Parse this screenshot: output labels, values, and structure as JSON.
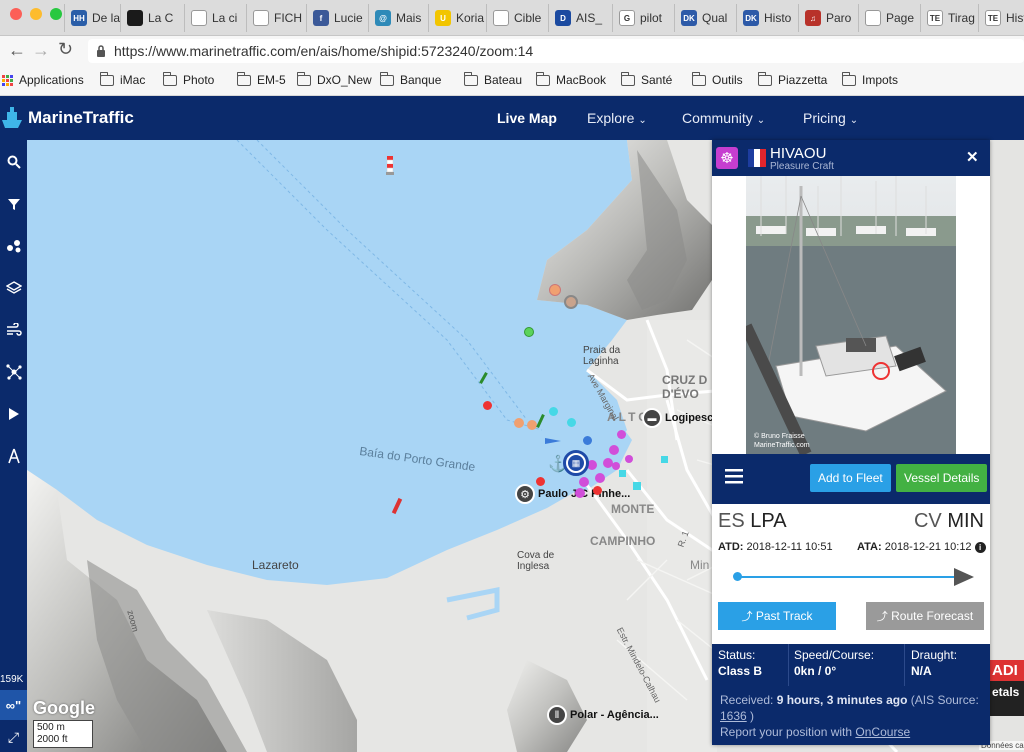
{
  "browser": {
    "tabs": [
      {
        "label": "De la",
        "icon": "hh-favicon",
        "color": "#2a5ea8",
        "glyph": "HH"
      },
      {
        "label": "La C",
        "icon": "flag-favicon",
        "color": "#1a1a1a",
        "glyph": ""
      },
      {
        "label": "La ci",
        "icon": "doc-favicon",
        "color": "#ffffff",
        "glyph": ""
      },
      {
        "label": "FICH",
        "icon": "doc-favicon",
        "color": "#ffffff",
        "glyph": ""
      },
      {
        "label": "Lucie",
        "icon": "facebook-favicon",
        "color": "#3b5998",
        "glyph": "f"
      },
      {
        "label": "Mais",
        "icon": "leaf-favicon",
        "color": "#2e8ab8",
        "glyph": "@"
      },
      {
        "label": "Koria",
        "icon": "smiley-favicon",
        "color": "#f2c500",
        "glyph": "U"
      },
      {
        "label": "Cible",
        "icon": "doc-favicon",
        "color": "#ffffff",
        "glyph": ""
      },
      {
        "label": "AIS_",
        "icon": "ais-favicon",
        "color": "#1b4aa0",
        "glyph": "D"
      },
      {
        "label": "pilot",
        "icon": "google-favicon",
        "color": "#ffffff",
        "glyph": "G"
      },
      {
        "label": "Qual",
        "icon": "dk-favicon",
        "color": "#2d5aa8",
        "glyph": "DK"
      },
      {
        "label": "Histo",
        "icon": "dk-favicon",
        "color": "#2d5aa8",
        "glyph": "DK"
      },
      {
        "label": "Paro",
        "icon": "music-favicon",
        "color": "#b8322a",
        "glyph": "♫"
      },
      {
        "label": "Page",
        "icon": "doc-favicon",
        "color": "#ffffff",
        "glyph": ""
      },
      {
        "label": "Tirag",
        "icon": "te-favicon",
        "color": "#ffffff",
        "glyph": "TE"
      },
      {
        "label": "Hist",
        "icon": "te-favicon",
        "color": "#ffffff",
        "glyph": "TE"
      }
    ],
    "url": "https://www.marinetraffic.com/en/ais/home/shipid:5723240/zoom:14",
    "bookmarks": [
      "Applications",
      "iMac",
      "Photo",
      "EM-5",
      "DxO_New",
      "Banque",
      "Bateau",
      "MacBook",
      "Santé",
      "Outils",
      "Piazzetta",
      "Impots"
    ]
  },
  "nav": {
    "brand": "MarineTraffic",
    "live_map": "Live Map",
    "explore": "Explore",
    "community": "Community",
    "pricing": "Pricing"
  },
  "map": {
    "labels": {
      "bay": "Baía do Porto Grande",
      "lazareto": "Lazareto",
      "praia": "Praia da\nLaginha",
      "cruz": "CRUZ D\nD'ÉVO",
      "alto": "ALTO",
      "monte": "MONTE",
      "campinho": "CAMPINHO",
      "cova": "Cova de\nInglesa",
      "av_marginal": "Ave Marginal",
      "mi": "Min",
      "estr": "Estr. Mindelo-Calhau",
      "r1": "R. 1",
      "zoom": "zoom",
      "logipesca": "Logipesc",
      "paulo": "Paulo J C Pinhe...",
      "polar": "Polar - Agência...",
      "google": "Google",
      "scale_m": "500 m",
      "scale_ft": "2000 ft",
      "left_count": "159K",
      "ad_fragment": "ADI",
      "details_fragment": "etals",
      "donnees": "Données cartog"
    }
  },
  "vessel": {
    "name": "HIVAOU",
    "type": "Pleasure Craft",
    "photo_credit": "© Bruno Fraisse\nMarineTraffic.com",
    "add_to_fleet": "Add to Fleet",
    "vessel_details": "Vessel Details",
    "origin_country": "ES",
    "origin_port": "LPA",
    "dest_country": "CV",
    "dest_port": "MIN",
    "atd_label": "ATD:",
    "atd_value": "2018-12-11 10:51",
    "ata_label": "ATA:",
    "ata_value": "2018-12-21 10:12",
    "past_track": "Past Track",
    "route_forecast": "Route Forecast",
    "status_label": "Status:",
    "status_value": "Class B",
    "speed_label": "Speed/Course:",
    "speed_value": "0kn / 0°",
    "draught_label": "Draught:",
    "draught_value": "N/A",
    "received_prefix": "Received:",
    "received_value": "9 hours, 3 minutes ago",
    "ais_prefix": "(AIS Source:",
    "ais_source": "1636",
    "ais_suffix": ")",
    "report_text": "Report your position with",
    "oncourse": "OnCourse"
  },
  "colors": {
    "navy": "#0b2a6b",
    "water": "#a9d5f5",
    "accent_blue": "#2aa0e6",
    "accent_green": "#43b143"
  }
}
